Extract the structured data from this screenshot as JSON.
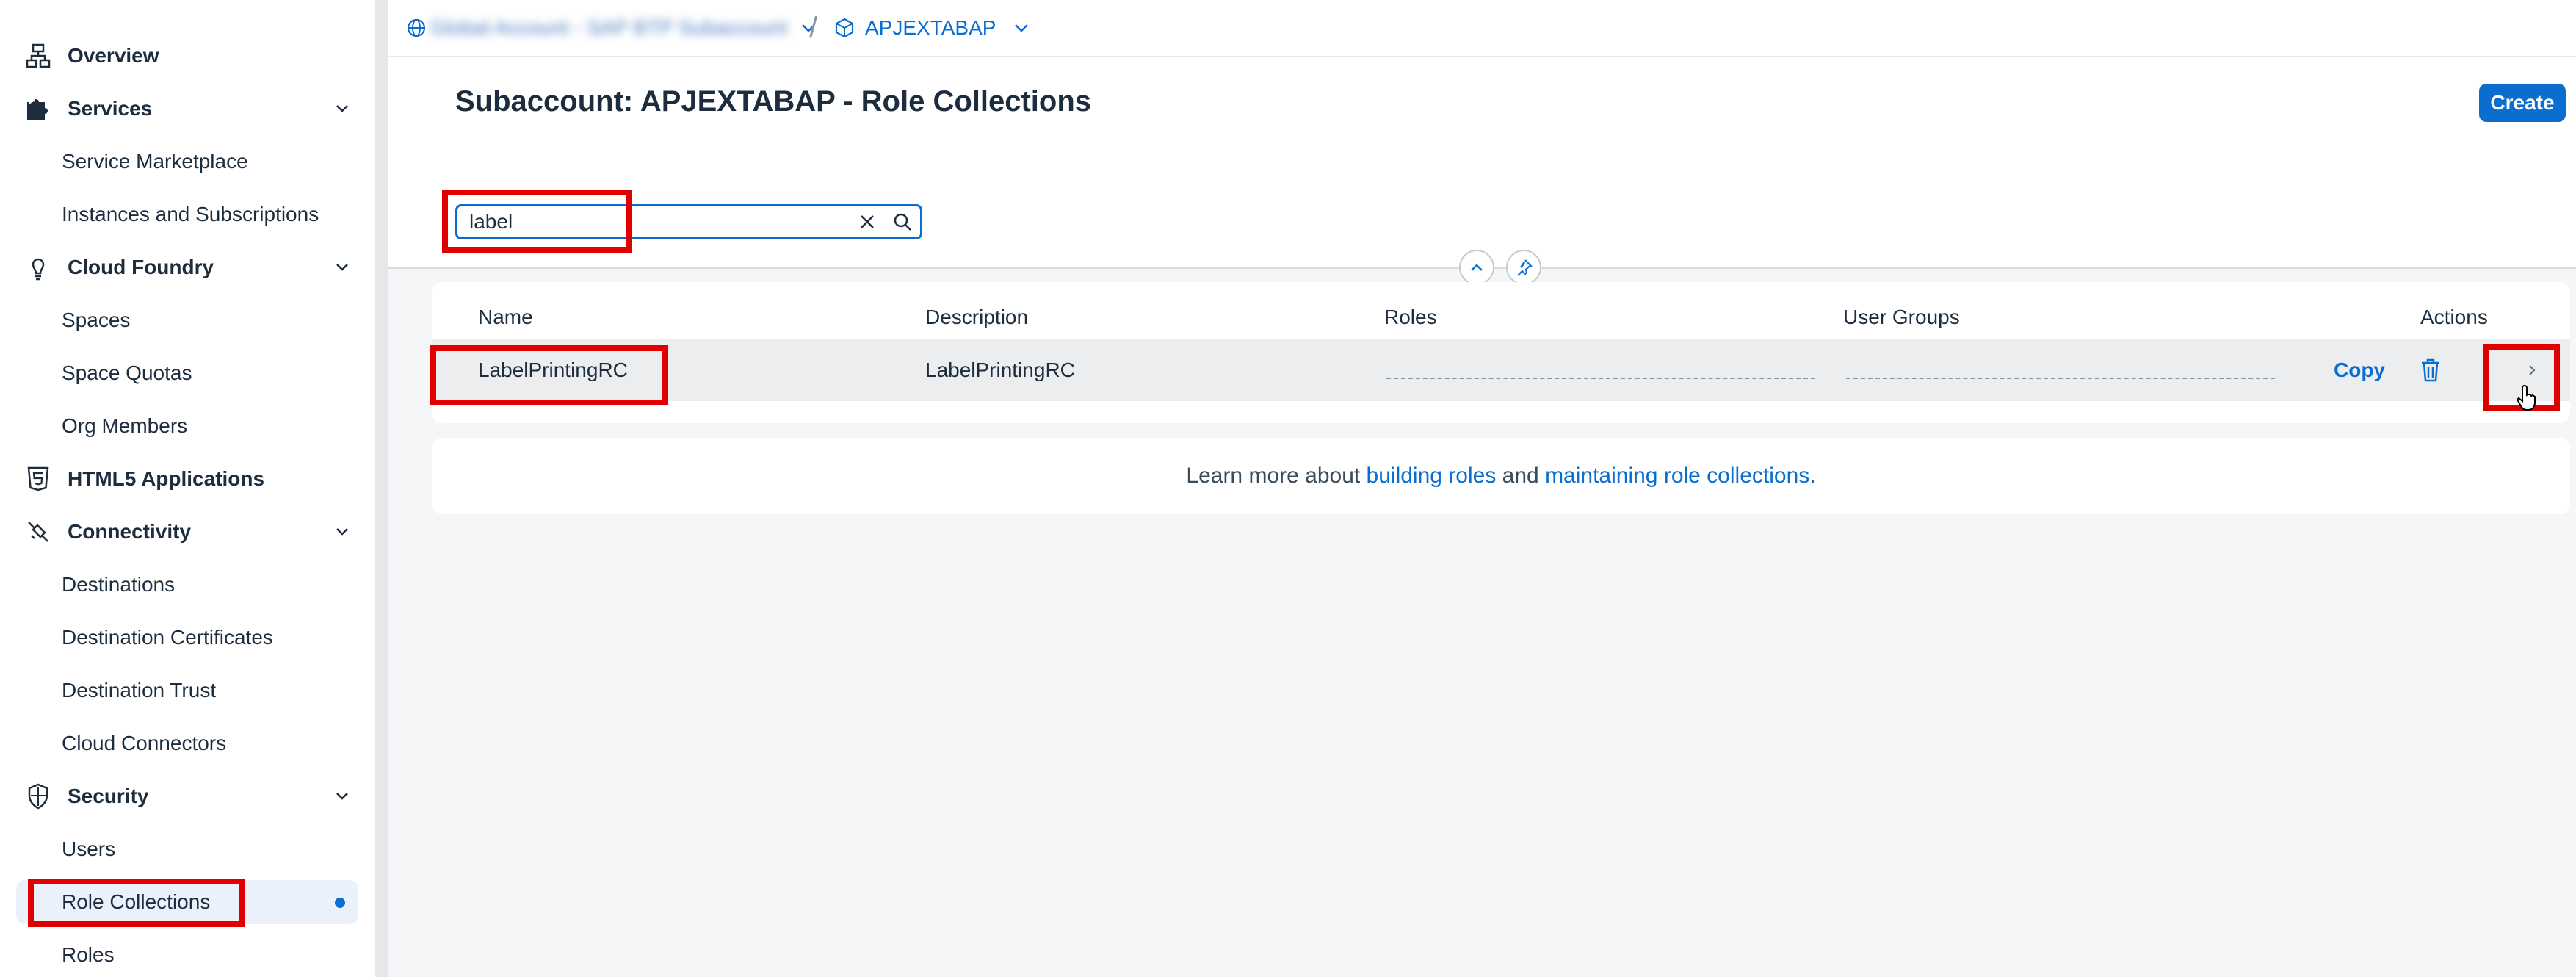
{
  "sidebar": {
    "groups": [
      {
        "label": "Overview",
        "icon": "hierarchy-icon"
      },
      {
        "label": "Services",
        "icon": "puzzle-icon"
      },
      {
        "label": "Cloud Foundry",
        "icon": "cloud-foundry-icon"
      },
      {
        "label": "HTML5 Applications",
        "icon": "html5-icon"
      },
      {
        "label": "Connectivity",
        "icon": "connectivity-icon"
      },
      {
        "label": "Security",
        "icon": "shield-icon"
      }
    ],
    "items": {
      "service_marketplace": "Service Marketplace",
      "instances_subscriptions": "Instances and Subscriptions",
      "spaces": "Spaces",
      "space_quotas": "Space Quotas",
      "org_members": "Org Members",
      "destinations": "Destinations",
      "destination_certificates": "Destination Certificates",
      "destination_trust": "Destination Trust",
      "cloud_connectors": "Cloud Connectors",
      "users": "Users",
      "role_collections": "Role Collections",
      "roles": "Roles"
    },
    "selected": "Role Collections"
  },
  "breadcrumb": {
    "global_account": "Global Account - SAP BTP Subaccount",
    "subaccount": "APJEXTABAP"
  },
  "header": {
    "title": "Subaccount: APJEXTABAP - Role Collections",
    "create_label": "Create"
  },
  "search": {
    "value": "label"
  },
  "table": {
    "columns": {
      "name": "Name",
      "description": "Description",
      "roles": "Roles",
      "user_groups": "User Groups",
      "actions": "Actions"
    },
    "rows": [
      {
        "name": "LabelPrintingRC",
        "description": "LabelPrintingRC",
        "roles": "",
        "user_groups": "",
        "copy_label": "Copy"
      }
    ]
  },
  "info": {
    "prefix": "Learn more about ",
    "link1": "building roles",
    "middle": " and ",
    "link2": "maintaining role collections",
    "suffix": "."
  },
  "colors": {
    "accent": "#0a6ed1",
    "highlight": "#e00000",
    "selected_bg": "#eaf1fb"
  }
}
